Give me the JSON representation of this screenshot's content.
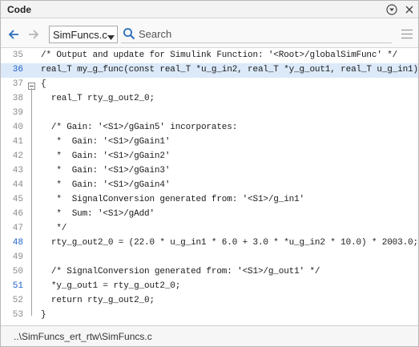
{
  "panel": {
    "title": "Code"
  },
  "toolbar": {
    "file_label": "SimFuncs.c",
    "search_placeholder": "Search"
  },
  "code": {
    "lines": [
      {
        "number": "35",
        "text": "/* Output and update for Simulink Function: '<Root>/globalSimFunc' */",
        "highlight": false,
        "active": false
      },
      {
        "number": "36",
        "text": "real_T my_g_func(const real_T *u_g_in2, real_T *y_g_out1, real_T u_g_in1)",
        "highlight": true,
        "active": true
      },
      {
        "number": "37",
        "text": "{",
        "highlight": false,
        "active": false
      },
      {
        "number": "38",
        "text": "  real_T rty_g_out2_0;",
        "highlight": false,
        "active": false
      },
      {
        "number": "39",
        "text": "",
        "highlight": false,
        "active": false
      },
      {
        "number": "40",
        "text": "  /* Gain: '<S1>/gGain5' incorporates:",
        "highlight": false,
        "active": false
      },
      {
        "number": "41",
        "text": "   *  Gain: '<S1>/gGain1'",
        "highlight": false,
        "active": false
      },
      {
        "number": "42",
        "text": "   *  Gain: '<S1>/gGain2'",
        "highlight": false,
        "active": false
      },
      {
        "number": "43",
        "text": "   *  Gain: '<S1>/gGain3'",
        "highlight": false,
        "active": false
      },
      {
        "number": "44",
        "text": "   *  Gain: '<S1>/gGain4'",
        "highlight": false,
        "active": false
      },
      {
        "number": "45",
        "text": "   *  SignalConversion generated from: '<S1>/g_in1'",
        "highlight": false,
        "active": false
      },
      {
        "number": "46",
        "text": "   *  Sum: '<S1>/gAdd'",
        "highlight": false,
        "active": false
      },
      {
        "number": "47",
        "text": "   */",
        "highlight": false,
        "active": false
      },
      {
        "number": "48",
        "text": "  rty_g_out2_0 = (22.0 * u_g_in1 * 6.0 + 3.0 * *u_g_in2 * 10.0) * 2003.0;",
        "highlight": false,
        "active": true
      },
      {
        "number": "49",
        "text": "",
        "highlight": false,
        "active": false
      },
      {
        "number": "50",
        "text": "  /* SignalConversion generated from: '<S1>/g_out1' */",
        "highlight": false,
        "active": false
      },
      {
        "number": "51",
        "text": "  *y_g_out1 = rty_g_out2_0;",
        "highlight": false,
        "active": true
      },
      {
        "number": "52",
        "text": "  return rty_g_out2_0;",
        "highlight": false,
        "active": false
      },
      {
        "number": "53",
        "text": "}",
        "highlight": false,
        "active": false
      }
    ]
  },
  "status": {
    "path": "..\\SimFuncs_ert_rtw\\SimFuncs.c"
  },
  "colors": {
    "highlight": "#dbe9f9",
    "active_line_number": "#1f62c7",
    "accent_blue": "#2a6ebb"
  }
}
